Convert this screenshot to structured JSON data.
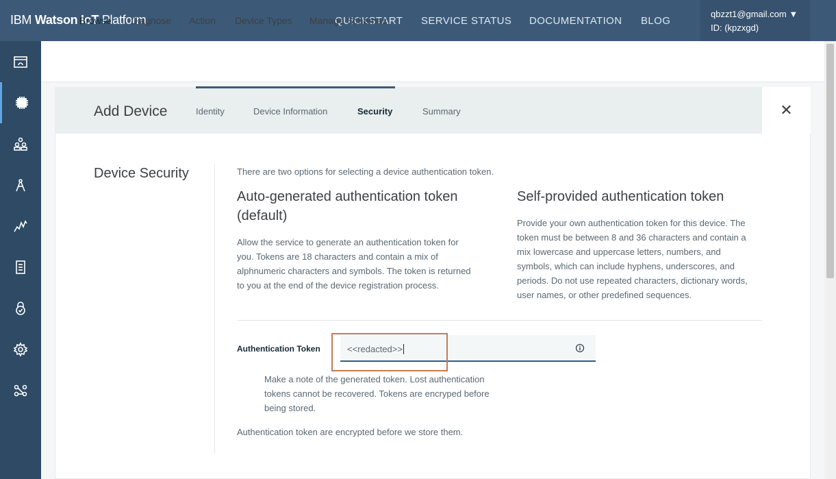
{
  "app": {
    "brand_prefix": "IBM ",
    "brand_bold": "Watson IoT",
    "brand_suffix": " Platform"
  },
  "topnav": {
    "items": [
      "QUICKSTART",
      "SERVICE STATUS",
      "DOCUMENTATION",
      "BLOG"
    ]
  },
  "account": {
    "email": "qbzzt1@gmail.com ▼",
    "id": "ID: (kpzxgd)"
  },
  "sidebar": {
    "icons": [
      "boards-icon",
      "devices-icon",
      "members-icon",
      "apps-icon",
      "usage-icon",
      "rules-icon",
      "security-icon",
      "settings-icon",
      "extensions-icon"
    ],
    "active_index": 1
  },
  "subnav": {
    "tabs": [
      "Browse",
      "Diagnose",
      "Action",
      "Device Types",
      "Manage Schemas"
    ],
    "active_index": 0
  },
  "wizard": {
    "title": "Add Device",
    "steps": [
      "Identity",
      "Device Information",
      "Security",
      "Summary"
    ],
    "active_step": 2,
    "close_glyph": "✕"
  },
  "security": {
    "section_title": "Device Security",
    "intro": "There are two options for selecting a device authentication token.",
    "auto_title_line1": "Auto-generated authentication token",
    "auto_title_line2": "(default)",
    "auto_desc": [
      "Allow the service to generate an authentication token for",
      "you. Tokens are 18 characters and contain a mix of",
      "alphnumeric characters and symbols. The token is returned",
      "to you at the end of the device registration process."
    ],
    "self_title": "Self-provided authentication token",
    "self_desc": [
      "Provide your own authentication token for this device. The",
      "token must be between 8 and 36 characters and contain a",
      "mix lowercase and uppercase letters, numbers, and",
      "symbols, which can include hyphens, underscores, and",
      "periods. Do not use repeated characters, dictionary words,",
      "user names, or other predefined sequences."
    ],
    "field_label": "Authentication Token",
    "token_value": "<<redacted>>",
    "note": [
      "Make a note of the generated token. Lost authentication",
      "tokens cannot be recovered. Tokens are encryped before",
      "being stored."
    ],
    "footer_note": "Authentication token are encrypted before we store them."
  },
  "colors": {
    "topbar": "#3c5a78",
    "sidebar": "#2e4a64",
    "highlight": "#c67a52",
    "accent": "#3c5a78"
  }
}
